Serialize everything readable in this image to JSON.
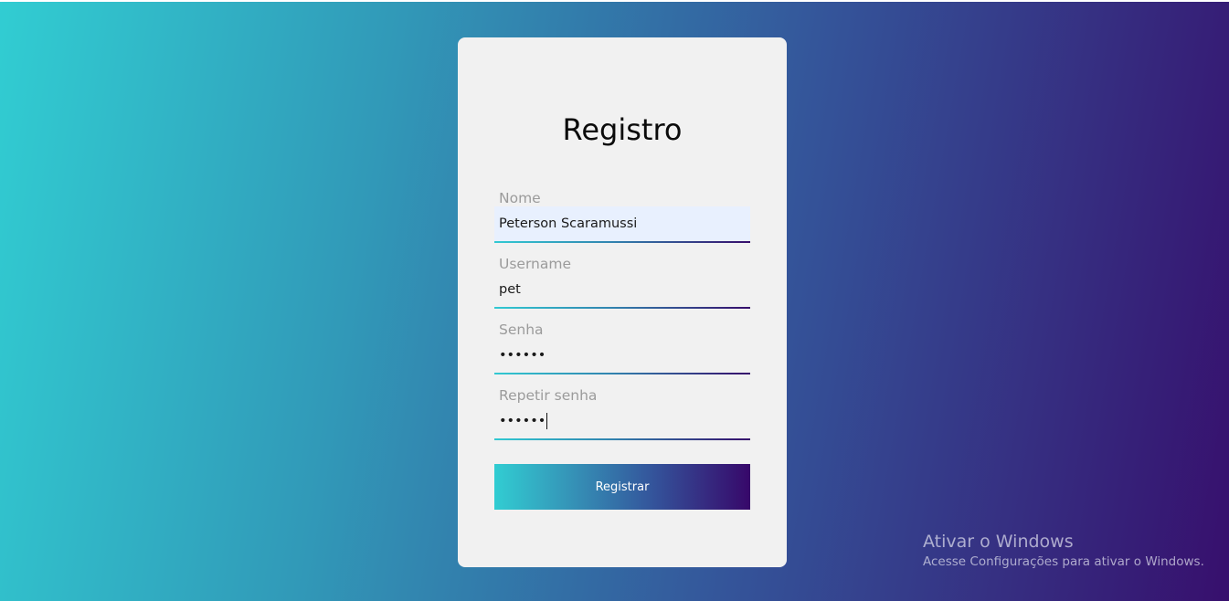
{
  "form": {
    "title": "Registro",
    "fields": [
      {
        "label": "Nome",
        "value": "Peterson Scaramussi"
      },
      {
        "label": "Username",
        "value": "pet"
      },
      {
        "label": "Senha",
        "value": "••••••"
      },
      {
        "label": "Repetir senha",
        "value": "••••••"
      }
    ],
    "submit_label": "Registrar"
  },
  "watermark": {
    "title": "Ativar o Windows",
    "subtitle": "Acesse Configurações para ativar o Windows."
  }
}
